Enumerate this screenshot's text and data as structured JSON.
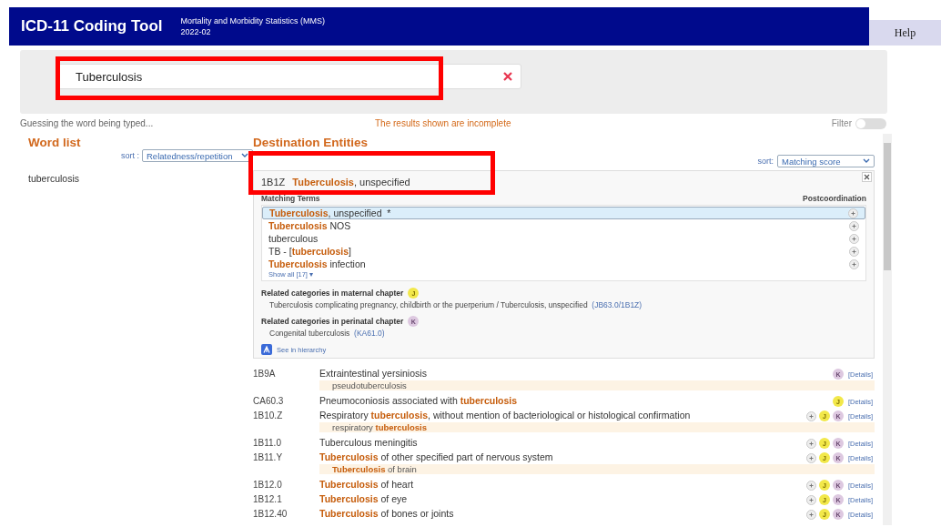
{
  "header": {
    "title": "ICD-11 Coding Tool",
    "subtitle": "Mortality and Morbidity Statistics (MMS)",
    "version": "2022-02",
    "help": "Help"
  },
  "search": {
    "value": "Tuberculosis",
    "highlighted": true
  },
  "status": {
    "hint": "Guessing the word being typed...",
    "notice": "The results shown are incomplete",
    "filter": {
      "label": "Filter",
      "on": false
    }
  },
  "word_list": {
    "title": "Word list",
    "sort_label": "sort :",
    "sort_value": "Relatedness/repetition",
    "words": [
      "tuberculosis"
    ]
  },
  "destination": {
    "title": "Destination Entities",
    "sort_label": "sort:",
    "sort_value": "Matching score",
    "selected_entity": {
      "code": "1B1Z",
      "title": "**Tuberculosis**, unspecified",
      "highlighted": true,
      "terms_heading": "Matching Terms",
      "postcoordination_heading": "Postcoordination",
      "terms": [
        {
          "text": "**Tuberculosis**, unspecified  *",
          "selected": true
        },
        {
          "text": "**Tuberculosis** NOS",
          "selected": false
        },
        {
          "text": "tuberculous",
          "selected": false
        },
        {
          "text": "TB - [**tuberculosis**]",
          "selected": false
        },
        {
          "text": "**Tuberculosis** infection",
          "selected": false
        }
      ],
      "show_all": "Show all [17] ▾",
      "related": [
        {
          "heading": "Related categories in maternal chapter",
          "badge": {
            "label": "J",
            "kind": "maternal"
          },
          "text": "Tuberculosis complicating pregnancy, childbirth or the puerperium / Tuberculosis, unspecified",
          "link": "(JB63.0/1B1Z)"
        },
        {
          "heading": "Related categories in perinatal chapter",
          "badge": {
            "label": "K",
            "kind": "perinatal"
          },
          "text": "Congenital tuberculosis",
          "link": "(KA61.0)"
        }
      ],
      "hierarchy": "See in hierarchy"
    },
    "results": [
      {
        "code": "1B9A",
        "title": "Extraintestinal yersiniosis",
        "synonym": "pseudotuberculosis",
        "postcoordination": false,
        "badges": [
          {
            "label": "K",
            "kind": "perinatal"
          }
        ],
        "details": "[Details]"
      },
      {
        "code": "CA60.3",
        "title": "Pneumoconiosis associated with **tuberculosis**",
        "postcoordination": false,
        "badges": [
          {
            "label": "J",
            "kind": "maternal"
          }
        ],
        "details": "[Details]"
      },
      {
        "code": "1B10.Z",
        "title": "Respiratory **tuberculosis**, without mention of bacteriological or histological confirmation",
        "synonym": "respiratory **tuberculosis**",
        "postcoordination": true,
        "badges": [
          {
            "label": "J",
            "kind": "maternal"
          },
          {
            "label": "K",
            "kind": "perinatal"
          }
        ],
        "details": "[Details]"
      },
      {
        "code": "1B11.0",
        "title": "Tuberculous meningitis",
        "postcoordination": true,
        "badges": [
          {
            "label": "J",
            "kind": "maternal"
          },
          {
            "label": "K",
            "kind": "perinatal"
          }
        ],
        "details": "[Details]"
      },
      {
        "code": "1B11.Y",
        "title": "**Tuberculosis** of other specified part of nervous system",
        "synonym": "**Tuberculosis** of brain",
        "postcoordination": true,
        "badges": [
          {
            "label": "J",
            "kind": "maternal"
          },
          {
            "label": "K",
            "kind": "perinatal"
          }
        ],
        "details": "[Details]"
      },
      {
        "code": "1B12.0",
        "title": "**Tuberculosis** of heart",
        "postcoordination": true,
        "badges": [
          {
            "label": "J",
            "kind": "maternal"
          },
          {
            "label": "K",
            "kind": "perinatal"
          }
        ],
        "details": "[Details]"
      },
      {
        "code": "1B12.1",
        "title": "**Tuberculosis** of eye",
        "postcoordination": true,
        "badges": [
          {
            "label": "J",
            "kind": "maternal"
          },
          {
            "label": "K",
            "kind": "perinatal"
          }
        ],
        "details": "[Details]"
      },
      {
        "code": "1B12.40",
        "title": "**Tuberculosis** of bones or joints",
        "postcoordination": true,
        "badges": [
          {
            "label": "J",
            "kind": "maternal"
          },
          {
            "label": "K",
            "kind": "perinatal"
          }
        ],
        "details": "[Details]"
      }
    ]
  }
}
